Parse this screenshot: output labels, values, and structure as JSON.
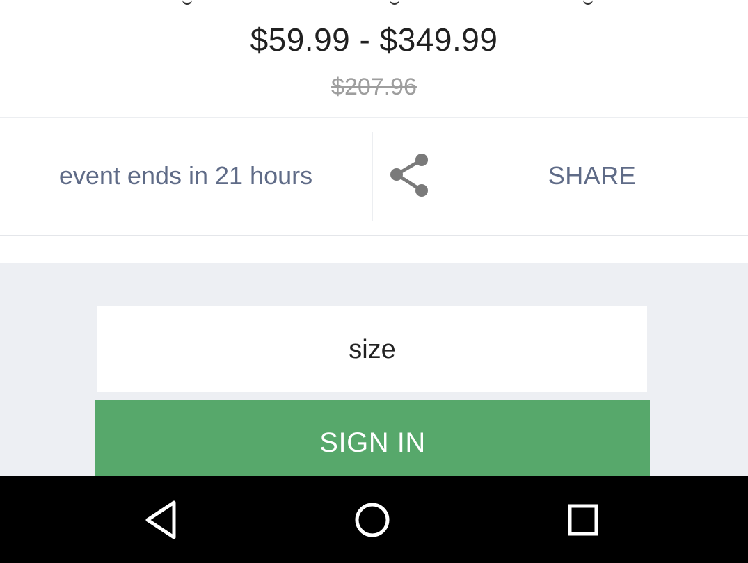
{
  "price": {
    "range": "$59.99 - $349.99",
    "original": "$207.96"
  },
  "event": {
    "countdown_text": "event ends in 21 hours"
  },
  "share": {
    "icon": "share-icon",
    "label": "SHARE"
  },
  "product_options": {
    "size_label": "size"
  },
  "actions": {
    "sign_in_label": "SIGN IN",
    "sign_in_color": "#57a86b"
  },
  "system_nav": {
    "back_icon": "back-triangle-icon",
    "home_icon": "home-circle-icon",
    "recents_icon": "recents-square-icon"
  }
}
